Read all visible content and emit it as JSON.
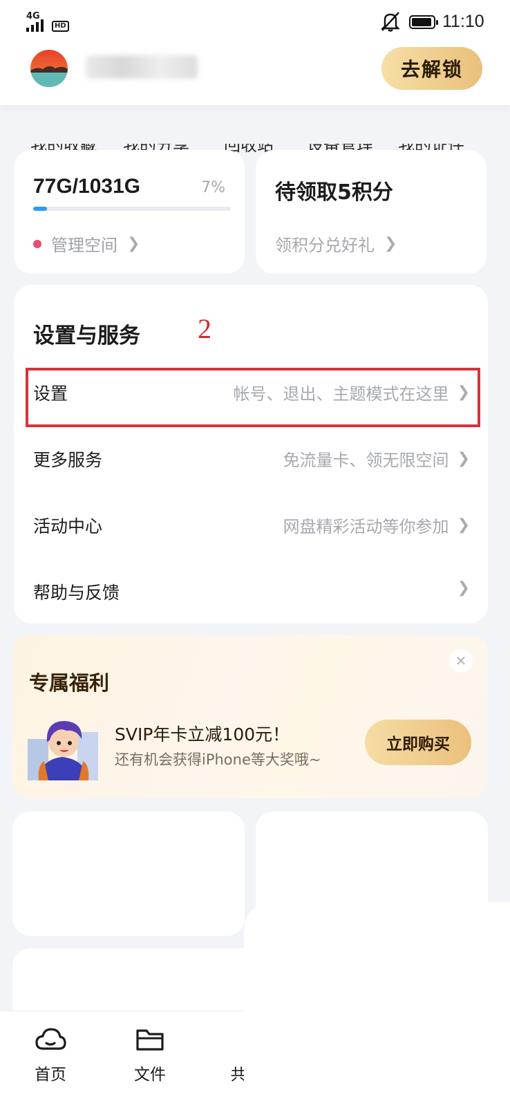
{
  "status_bar": {
    "network": "4G",
    "hd": "HD",
    "time": "11:10"
  },
  "header": {
    "unlock_button": "去解锁",
    "quick_links": [
      "我的收藏",
      "我的分享",
      "回收站",
      "设备管理",
      "我的证件"
    ]
  },
  "storage": {
    "amount": "77G/1031G",
    "percent_label": "7%",
    "used_fraction": 0.07,
    "manage_link": "管理空间"
  },
  "points": {
    "title": "待领取5积分",
    "subtitle": "领积分兑好礼"
  },
  "settings_section": {
    "title": "设置与服务",
    "annotation": "2",
    "rows": [
      {
        "label": "设置",
        "hint": "帐号、退出、主题模式在这里"
      },
      {
        "label": "更多服务",
        "hint": "免流量卡、领无限空间"
      },
      {
        "label": "活动中心",
        "hint": "网盘精彩活动等你参加"
      },
      {
        "label": "帮助与反馈",
        "hint": ""
      }
    ]
  },
  "welfare": {
    "title": "专属福利",
    "promo_title": "SVIP年卡立减100元！",
    "promo_subtitle": "还有机会获得iPhone等大奖哦~",
    "buy_button": "立即购买"
  },
  "tabbar": {
    "tabs": [
      {
        "label": "首页",
        "icon": "cloud-home-icon"
      },
      {
        "label": "文件",
        "icon": "folder-icon"
      },
      {
        "label": "共",
        "icon": "share-icon"
      }
    ]
  },
  "colors": {
    "accent_gold": "#e9c07b",
    "progress_blue": "#2f9bf0",
    "dot_red": "#ec4b6a",
    "annotation_red": "#d42a2a"
  }
}
